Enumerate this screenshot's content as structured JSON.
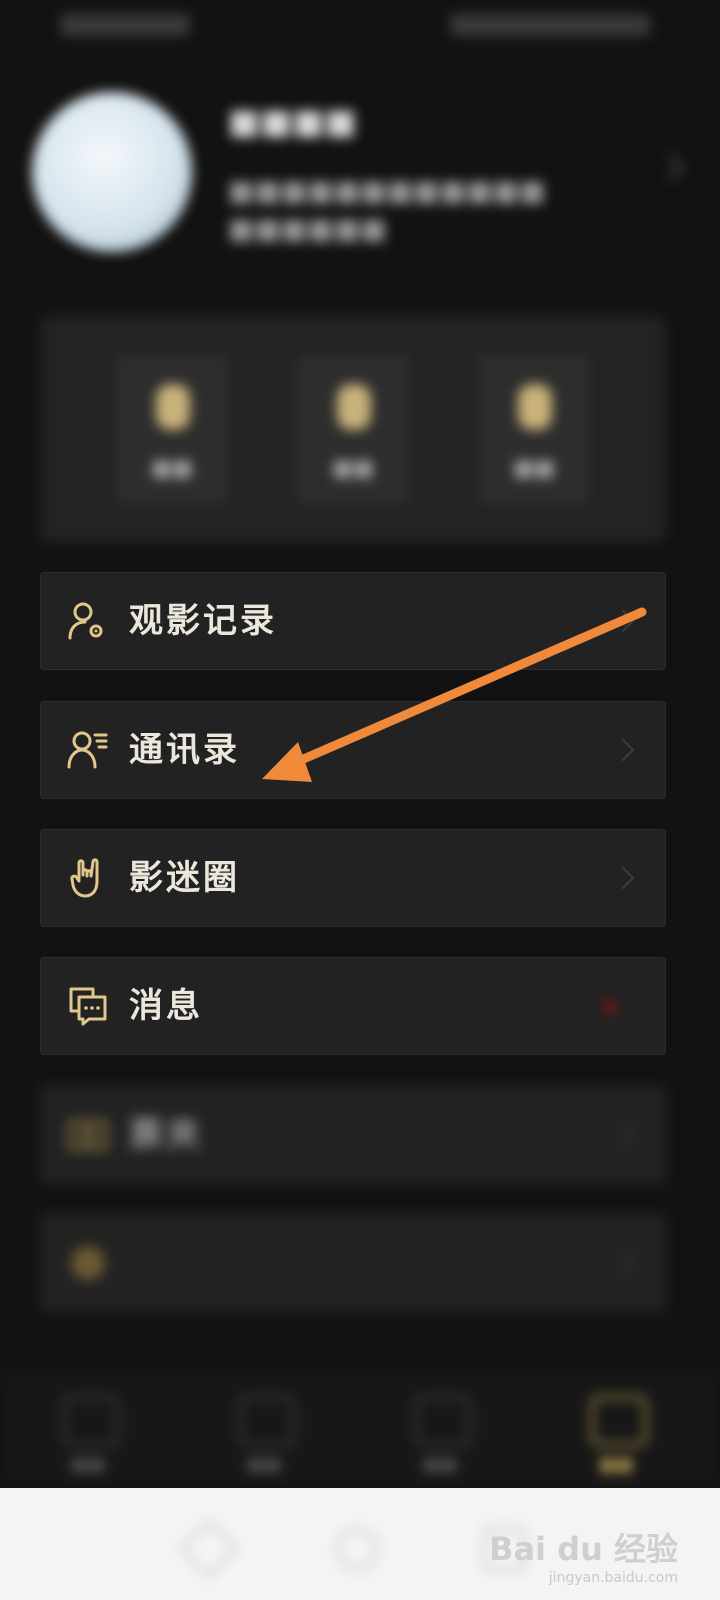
{
  "menu": {
    "items": [
      {
        "label": "观影记录",
        "icon": "user-gear-icon"
      },
      {
        "label": "通讯录",
        "icon": "contacts-icon"
      },
      {
        "label": "影迷圈",
        "icon": "rock-hand-icon"
      },
      {
        "label": "消息",
        "icon": "message-icon",
        "has_badge": true
      },
      {
        "label": "票夹",
        "icon": "ticket-icon"
      },
      {
        "label": "",
        "icon": "coin-icon"
      }
    ]
  },
  "colors": {
    "background": "#121212",
    "card": "#222222",
    "icon_gold": "#e2c78d",
    "annotation_arrow": "#f08a3a",
    "badge_red": "#7a1414"
  },
  "watermark": {
    "brand": "Bai du 经验",
    "url": "jingyan.baidu.com"
  }
}
